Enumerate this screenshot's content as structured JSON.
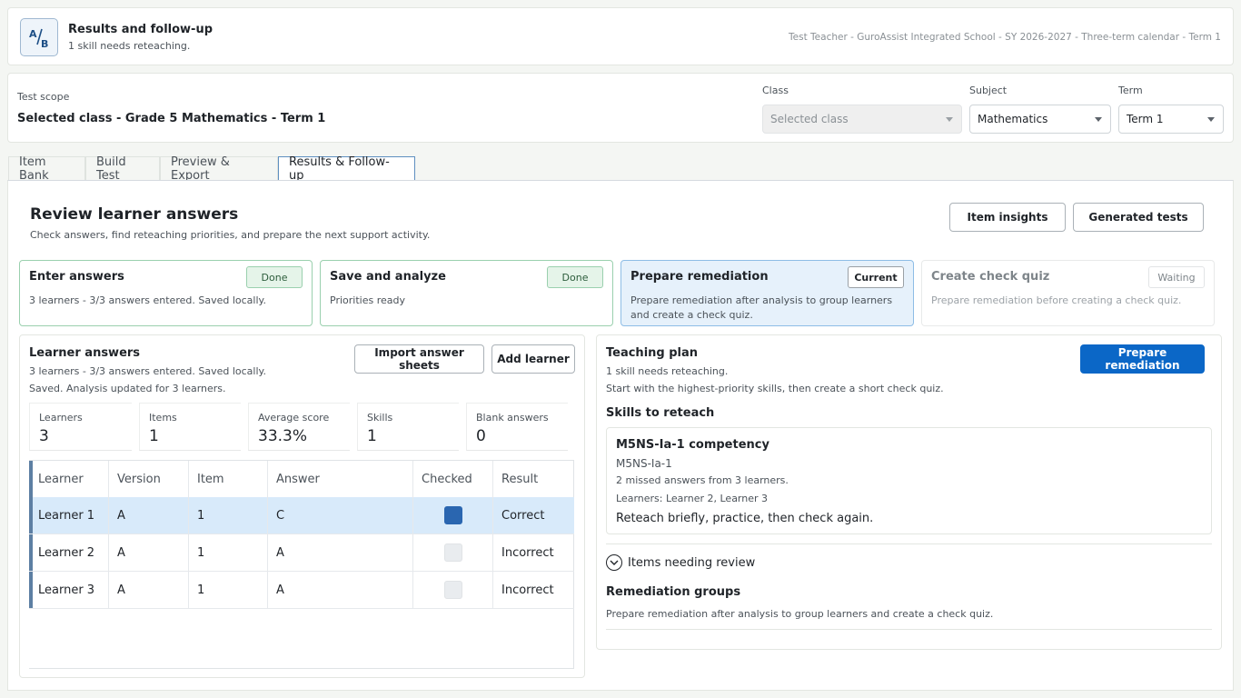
{
  "header": {
    "title": "Results and follow-up",
    "subtitle": "1 skill needs reteaching.",
    "context": "Test Teacher - GuroAssist Integrated School - SY 2026-2027 - Three-term calendar - Term 1"
  },
  "scope": {
    "label": "Test scope",
    "value": "Selected class - Grade 5 Mathematics - Term 1",
    "class_label": "Class",
    "class_value": "Selected class",
    "subject_label": "Subject",
    "subject_value": "Mathematics",
    "term_label": "Term",
    "term_value": "Term 1"
  },
  "tabs": [
    {
      "label": "Item Bank"
    },
    {
      "label": "Build Test"
    },
    {
      "label": "Preview & Export"
    },
    {
      "label": "Results & Follow-up"
    }
  ],
  "review": {
    "title": "Review learner answers",
    "subtitle": "Check answers, find reteaching priorities, and prepare the next support activity.",
    "item_insights_label": "Item insights",
    "generated_tests_label": "Generated tests"
  },
  "steps": [
    {
      "title": "Enter answers",
      "badge": "Done",
      "desc": "3 learners - 3/3 answers entered. Saved locally."
    },
    {
      "title": "Save and analyze",
      "badge": "Done",
      "desc": "Priorities ready"
    },
    {
      "title": "Prepare remediation",
      "badge": "Current",
      "desc": "Prepare remediation after analysis to group learners and create a check quiz."
    },
    {
      "title": "Create check quiz",
      "badge": "Waiting",
      "desc": "Prepare remediation before creating a check quiz."
    }
  ],
  "answers": {
    "title": "Learner answers",
    "line1": "3 learners - 3/3 answers entered. Saved locally.",
    "line2": "Saved. Analysis updated for 3 learners.",
    "import_label": "Import answer sheets",
    "add_label": "Add learner",
    "stats": [
      {
        "label": "Learners",
        "value": "3"
      },
      {
        "label": "Items",
        "value": "1"
      },
      {
        "label": "Average score",
        "value": "33.3%"
      },
      {
        "label": "Skills",
        "value": "1"
      },
      {
        "label": "Blank answers",
        "value": "0"
      }
    ],
    "columns": [
      "Learner",
      "Version",
      "Item",
      "Answer",
      "Checked",
      "Result"
    ],
    "rows": [
      {
        "learner": "Learner 1",
        "version": "A",
        "item": "1",
        "answer": "C",
        "checked": true,
        "result": "Correct"
      },
      {
        "learner": "Learner 2",
        "version": "A",
        "item": "1",
        "answer": "A",
        "checked": false,
        "result": "Incorrect"
      },
      {
        "learner": "Learner 3",
        "version": "A",
        "item": "1",
        "answer": "A",
        "checked": false,
        "result": "Incorrect"
      }
    ]
  },
  "plan": {
    "title": "Teaching plan",
    "line1": "1 skill needs reteaching.",
    "line2": "Start with the highest-priority skills, then create a short check quiz.",
    "prepare_label": "Prepare remediation",
    "skills_title": "Skills to reteach",
    "skill": {
      "name": "M5NS-Ia-1 competency",
      "code": "M5NS-Ia-1",
      "missed": "2 missed answers from 3 learners.",
      "learners": "Learners: Learner 2, Learner 3",
      "advice": "Reteach briefly, practice, then check again."
    },
    "items_review_label": "Items needing review",
    "groups_title": "Remediation groups",
    "groups_desc": "Prepare remediation after analysis to group learners and create a check quiz."
  },
  "colors": {
    "primary": "#0b67c7",
    "done_border": "#9ad0ae",
    "current_bg": "#e6f1fb",
    "selected_row": "#d8eafa"
  }
}
